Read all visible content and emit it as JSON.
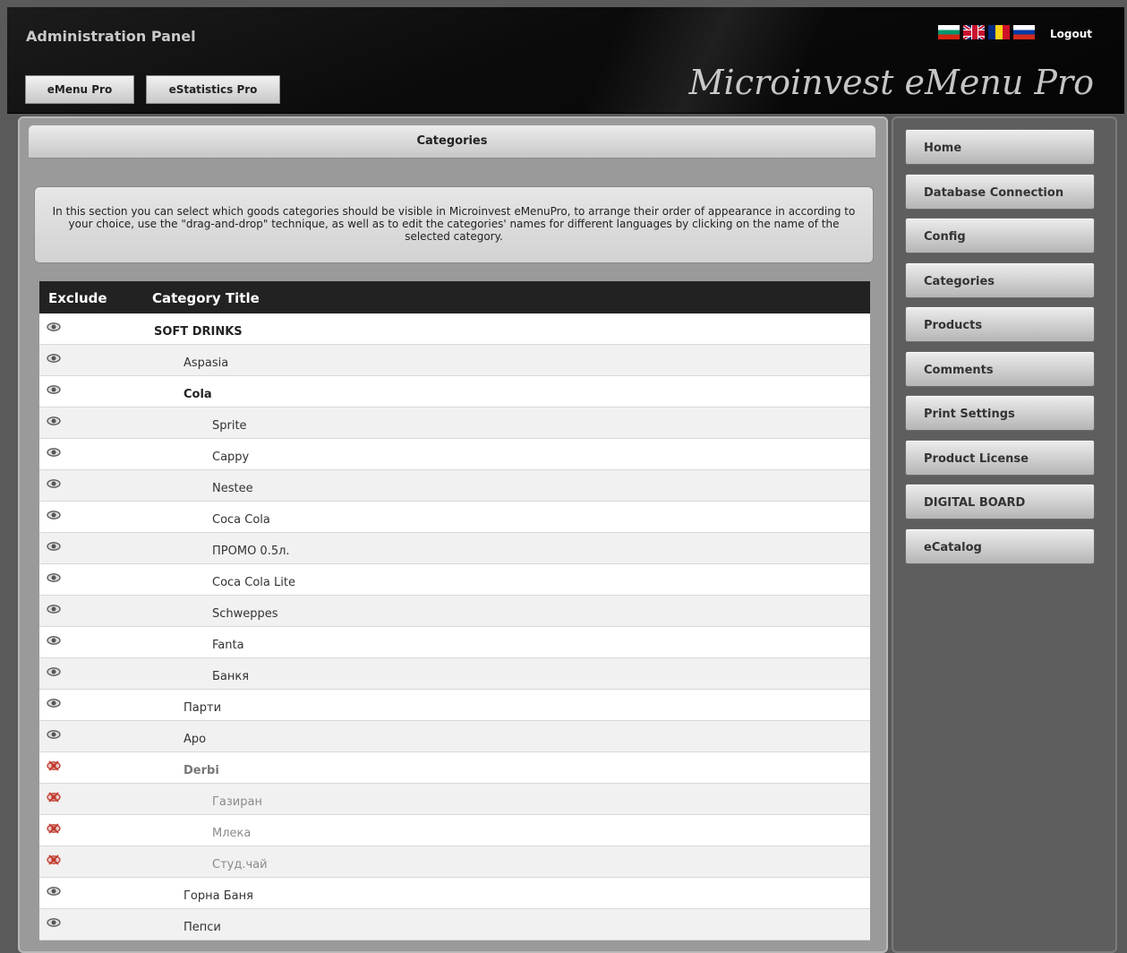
{
  "header": {
    "admin_title": "Administration Panel",
    "brand": "Microinvest  eMenu Pro",
    "logout": "Logout",
    "flags": [
      "bulgarian-flag-icon",
      "uk-flag-icon",
      "romanian-flag-icon",
      "russian-flag-icon"
    ],
    "buttons": {
      "emenu": "eMenu Pro",
      "estatistics": "eStatistics Pro"
    }
  },
  "main": {
    "section_title": "Categories",
    "info": "In this section you can select which goods categories should be visible in Microinvest eMenuPro, to arrange their order of appearance in according to your choice, use the \"drag-and-drop\" technique, as well as to edit the categories' names for different languages by clicking on the name of the selected category.",
    "table": {
      "columns": [
        "Exclude",
        "Category Title"
      ],
      "rows": [
        {
          "title": "SOFT DRINKS",
          "level": 0,
          "bold": true,
          "excluded": false
        },
        {
          "title": "Aspasia",
          "level": 1,
          "bold": false,
          "excluded": false
        },
        {
          "title": "Cola",
          "level": 1,
          "bold": true,
          "excluded": false
        },
        {
          "title": "Sprite",
          "level": 2,
          "bold": false,
          "excluded": false
        },
        {
          "title": "Cappy",
          "level": 2,
          "bold": false,
          "excluded": false
        },
        {
          "title": "Nestee",
          "level": 2,
          "bold": false,
          "excluded": false
        },
        {
          "title": "Coca Cola",
          "level": 2,
          "bold": false,
          "excluded": false
        },
        {
          "title": " ПРОМО 0.5л.",
          "level": 2,
          "bold": false,
          "excluded": false
        },
        {
          "title": "Coca Cola Lite",
          "level": 2,
          "bold": false,
          "excluded": false
        },
        {
          "title": "Schweppes",
          "level": 2,
          "bold": false,
          "excluded": false
        },
        {
          "title": "Fanta",
          "level": 2,
          "bold": false,
          "excluded": false
        },
        {
          "title": "Банкя",
          "level": 2,
          "bold": false,
          "excluded": false
        },
        {
          "title": "Парти",
          "level": 1,
          "bold": false,
          "excluded": false
        },
        {
          "title": "Аро",
          "level": 1,
          "bold": false,
          "excluded": false
        },
        {
          "title": "Derbi",
          "level": 1,
          "bold": true,
          "excluded": true
        },
        {
          "title": "Газиран",
          "level": 2,
          "bold": false,
          "excluded": true
        },
        {
          "title": "Млека",
          "level": 2,
          "bold": false,
          "excluded": true
        },
        {
          "title": "Студ.чай",
          "level": 2,
          "bold": false,
          "excluded": true
        },
        {
          "title": "Горна Баня",
          "level": 1,
          "bold": false,
          "excluded": false
        },
        {
          "title": "Пепси",
          "level": 1,
          "bold": false,
          "excluded": false
        }
      ]
    }
  },
  "sidebar": {
    "items": [
      "Home",
      "Database Connection",
      "Config",
      "Categories",
      "Products",
      "Comments",
      "Print Settings",
      "Product License",
      "DIGITAL BOARD",
      "eCatalog"
    ]
  },
  "colors": {
    "header_bg": "#0b0b0b",
    "panel_bg": "#9a9a9a",
    "sidebar_bg": "#5e5e5e",
    "table_head": "#222222",
    "excluded_eye": "#c0392b"
  }
}
